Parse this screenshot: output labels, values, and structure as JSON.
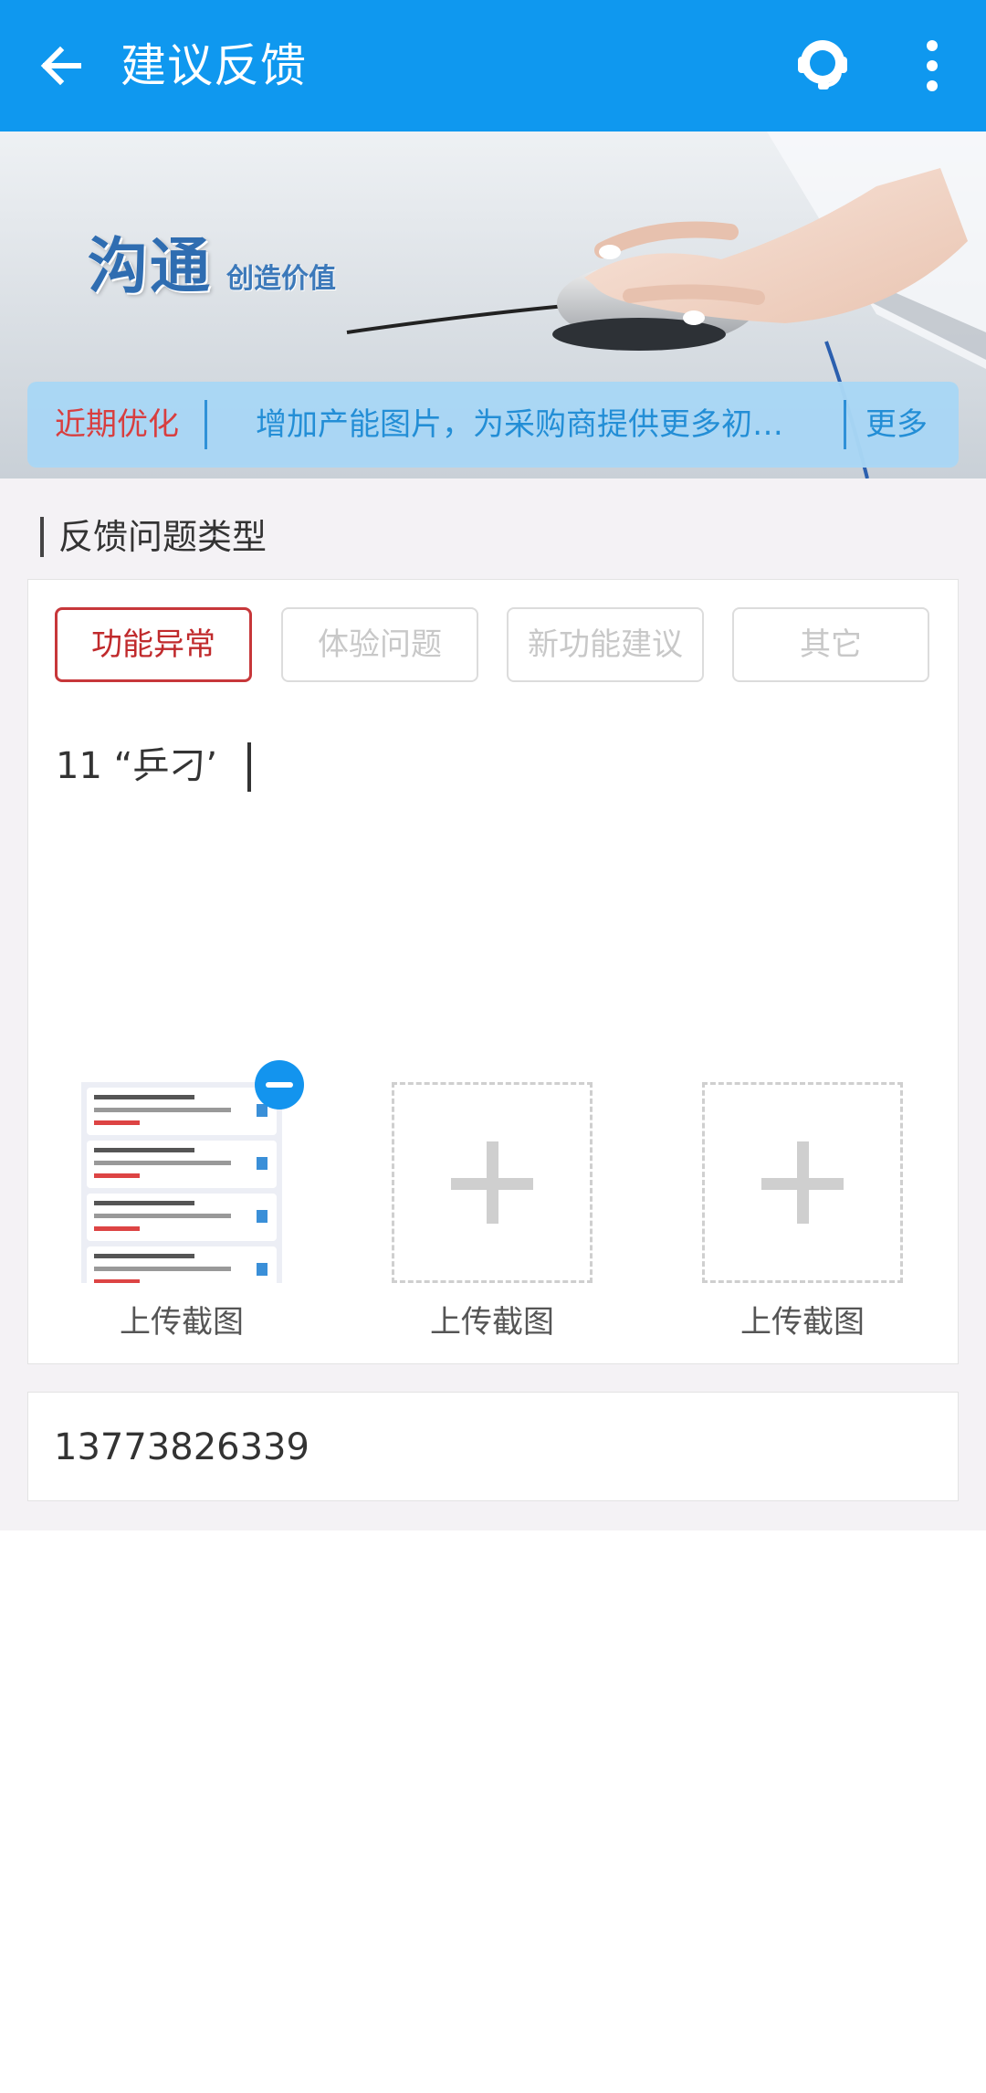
{
  "header": {
    "title": "建议反馈",
    "back_icon": "arrow-left-icon",
    "service_icon": "customer-service-headset-icon",
    "menu_icon": "more-vertical-icon",
    "bg_color": "#0f98ef"
  },
  "banner": {
    "slogan_main": "沟通",
    "slogan_sub": "创造价值"
  },
  "notice": {
    "tag": "近期优化",
    "text": "增加产能图片，为采购商提供更多初…",
    "more": "更多"
  },
  "section": {
    "title": "反馈问题类型"
  },
  "feedback_types": [
    {
      "label": "功能异常",
      "selected": true
    },
    {
      "label": "体验问题",
      "selected": false
    },
    {
      "label": "新功能建议",
      "selected": false
    },
    {
      "label": "其它",
      "selected": false
    }
  ],
  "feedback_text": "11 “乒刁’",
  "uploads": [
    {
      "label": "上传截图",
      "has_image": true,
      "remove_icon": "minus-circle-icon"
    },
    {
      "label": "上传截图",
      "has_image": false,
      "icon": "plus-icon"
    },
    {
      "label": "上传截图",
      "has_image": false,
      "icon": "plus-icon"
    }
  ],
  "contact": {
    "phone": "13773826339"
  }
}
